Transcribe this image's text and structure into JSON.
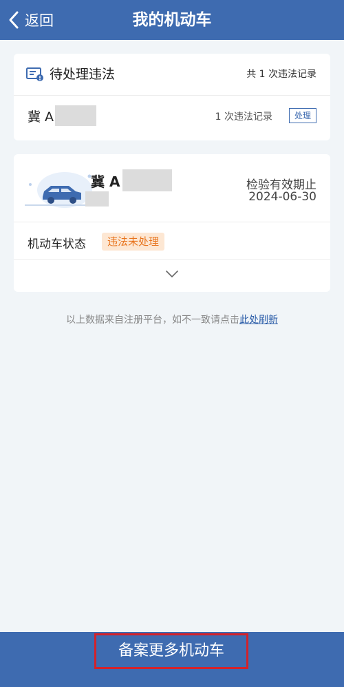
{
  "header": {
    "back_label": "返回",
    "title": "我的机动车"
  },
  "violations_card": {
    "title": "待处理违法",
    "summary": "共 1 次违法记录",
    "plate_prefix": "冀 A",
    "record_count": "1 次违法记录",
    "action_label": "处理"
  },
  "vehicle_card": {
    "plate_prefix": "冀 A",
    "inspection_label": "检验有效期止",
    "inspection_date": "2024-06-30",
    "status_label": "机动车状态",
    "status_badge": "违法未处理"
  },
  "notice": {
    "text": "以上数据来自注册平台，如不一致请点击",
    "link": "此处刷新"
  },
  "footer": {
    "button_label": "备案更多机动车"
  },
  "colors": {
    "brand": "#3e6bb0",
    "warning": "#e8741d",
    "highlight": "#d3222a"
  }
}
